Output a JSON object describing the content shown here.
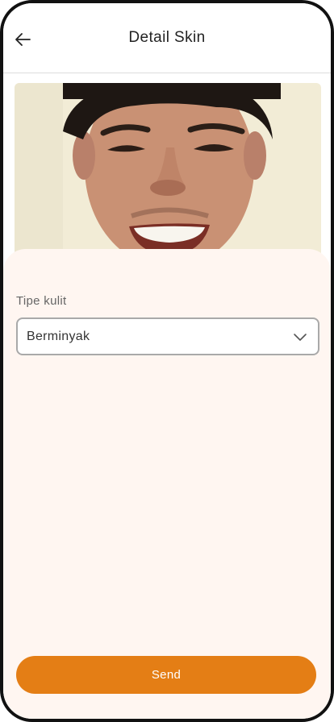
{
  "header": {
    "title": "Detail Skin",
    "back_icon": "arrow-left-icon"
  },
  "photo": {
    "subject": "face-photo"
  },
  "form": {
    "skin_type_label": "Tipe kulit",
    "skin_type_value": "Berminyak",
    "dropdown_icon": "chevron-down-icon"
  },
  "actions": {
    "send_label": "Send"
  },
  "colors": {
    "accent": "#e47e15",
    "sheet_background": "#fff6f1",
    "border": "#a9a9a9"
  }
}
